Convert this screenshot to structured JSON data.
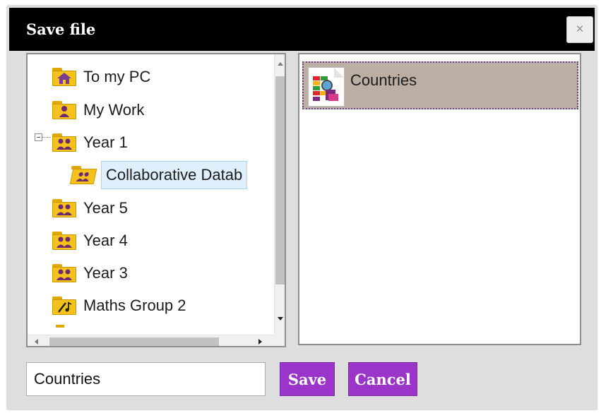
{
  "dialog": {
    "title": "Save file",
    "close_glyph": "×"
  },
  "tree": {
    "items": [
      {
        "label": "To my PC",
        "icon": "home-folder-icon"
      },
      {
        "label": "My Work",
        "icon": "user-folder-icon"
      },
      {
        "label": "Year 1",
        "icon": "group-folder-icon",
        "expanded": true
      },
      {
        "label": "Collaborative Datab",
        "icon": "shared-folder-icon",
        "selected": true
      },
      {
        "label": "Year 5",
        "icon": "group-folder-icon"
      },
      {
        "label": "Year 4",
        "icon": "group-folder-icon"
      },
      {
        "label": "Year 3",
        "icon": "group-folder-icon"
      },
      {
        "label": "Maths Group 2",
        "icon": "music-folder-icon"
      }
    ]
  },
  "files": {
    "items": [
      {
        "label": "Countries",
        "icon": "database-file-icon",
        "selected": true
      }
    ]
  },
  "footer": {
    "filename_value": "Countries",
    "save_label": "Save",
    "cancel_label": "Cancel"
  },
  "colors": {
    "titlebar": "#000000",
    "accent_button": "#9b34c9",
    "selected_file_bg": "#bbaea3",
    "folder": "#f5c21b",
    "people_icon": "#6d2a73"
  }
}
